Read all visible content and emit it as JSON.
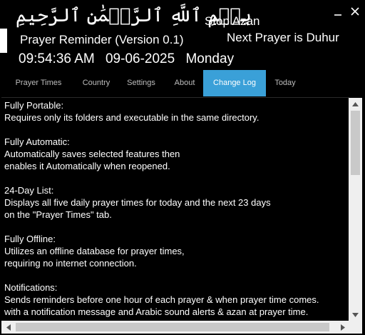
{
  "header": {
    "basmala": "بِسۡمِ ٱللَّهِ ٱلرَّحۡمَٰنِ ٱلرَّحِيمِ",
    "app_title": "Prayer Reminder (Version 0.1)",
    "time": "09:54:36 AM",
    "date": "09-06-2025",
    "weekday": "Monday",
    "stop_azan_label": "Stop Azan",
    "next_prayer_text": "Next Prayer is Duhur"
  },
  "window_controls": {
    "minimize_icon": "minimize-icon",
    "close_icon": "close-icon"
  },
  "tabs": [
    {
      "label": "Prayer Times"
    },
    {
      "label": "Country"
    },
    {
      "label": "Settings"
    },
    {
      "label": "About"
    },
    {
      "label": "Change Log",
      "active": true
    },
    {
      "label": "Today"
    }
  ],
  "change_log": {
    "lines": [
      "Fully Portable:",
      "Requires only its folders and executable in the same directory.",
      "",
      "Fully Automatic:",
      "Automatically saves selected features then",
      "enables it Automatically when reopened.",
      "",
      "24-Day List:",
      "Displays all five daily prayer times for today and the next 23 days",
      "on the \"Prayer Times\" tab.",
      "",
      "Fully Offline:",
      "Utilizes an offline database for prayer times,",
      "requiring no internet connection.",
      "",
      "Notifications:",
      "Sends reminders before one hour of each prayer & when prayer time comes.",
      "with a notification message and Arabic sound alerts & azan at prayer time."
    ]
  },
  "colors": {
    "background": "#000000",
    "text": "#ffffff",
    "active_tab": "#3aa0d8",
    "inactive_tab_text": "#bdbdbd",
    "scrollbar_track": "#efefef",
    "scrollbar_thumb": "#c9c9c9"
  }
}
